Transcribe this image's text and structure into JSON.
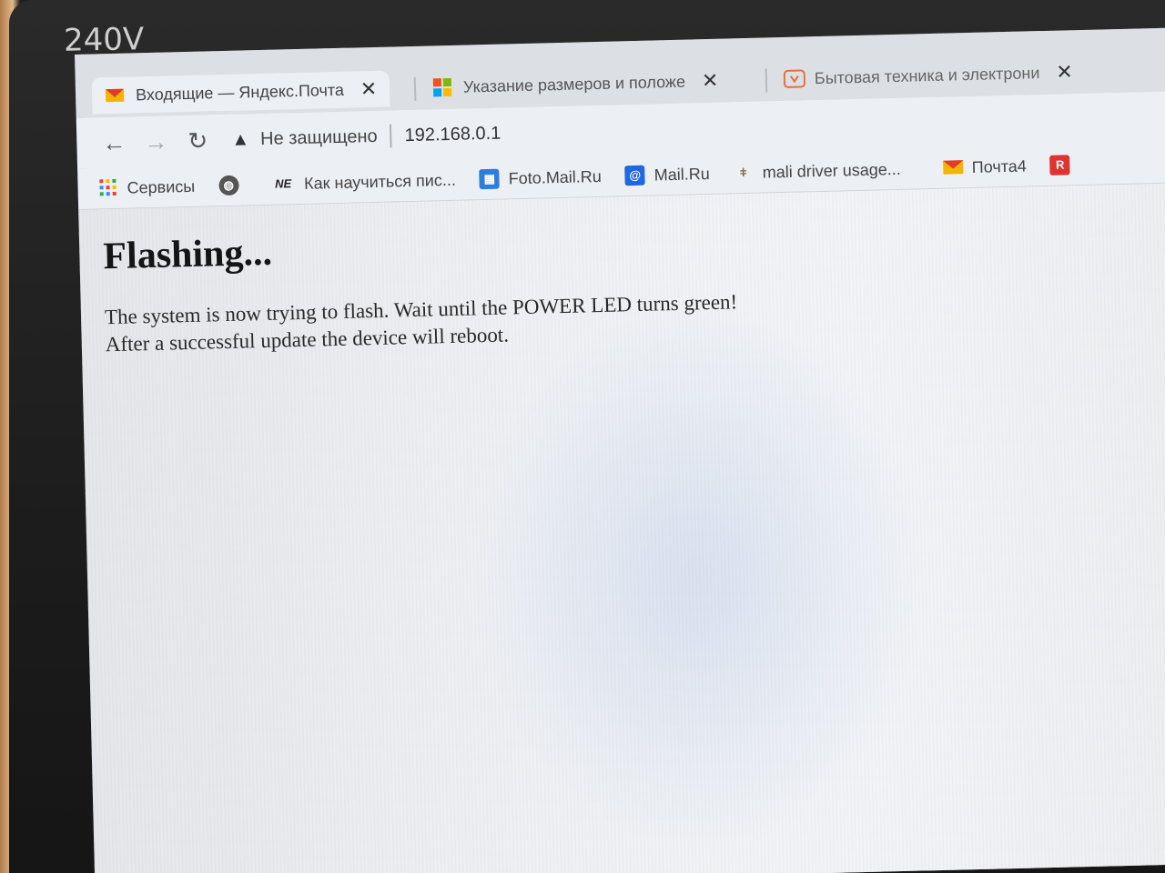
{
  "monitor": {
    "model_label": "240V"
  },
  "browser": {
    "tabs": [
      {
        "title": "Входящие — Яндекс.Почта",
        "icon": "yandex-mail-icon",
        "active": true
      },
      {
        "title": "Указание размеров и положе",
        "icon": "microsoft-icon",
        "active": false
      },
      {
        "title": "Бытовая техника и электрони",
        "icon": "store-icon",
        "active": false
      }
    ],
    "close_glyph": "✕",
    "security_label": "Не защищено",
    "url": "192.168.0.1",
    "bookmarks": [
      {
        "label": "Сервисы",
        "icon": "apps-grid-icon"
      },
      {
        "label": "",
        "icon": "globe-icon"
      },
      {
        "label": "Как научиться пис...",
        "icon": "ne-icon"
      },
      {
        "label": "Foto.Mail.Ru",
        "icon": "foto-mail-icon"
      },
      {
        "label": "Mail.Ru",
        "icon": "mail-ru-icon"
      },
      {
        "label": "mali driver usage...",
        "icon": "wolf-icon"
      },
      {
        "label": "Почта4",
        "icon": "mail-envelope-icon"
      },
      {
        "label": "",
        "icon": "r-badge-icon"
      }
    ]
  },
  "page": {
    "heading": "Flashing...",
    "line1": "The system is now trying to flash. Wait until the POWER LED turns green!",
    "line2": "After a successful update the device will reboot."
  }
}
